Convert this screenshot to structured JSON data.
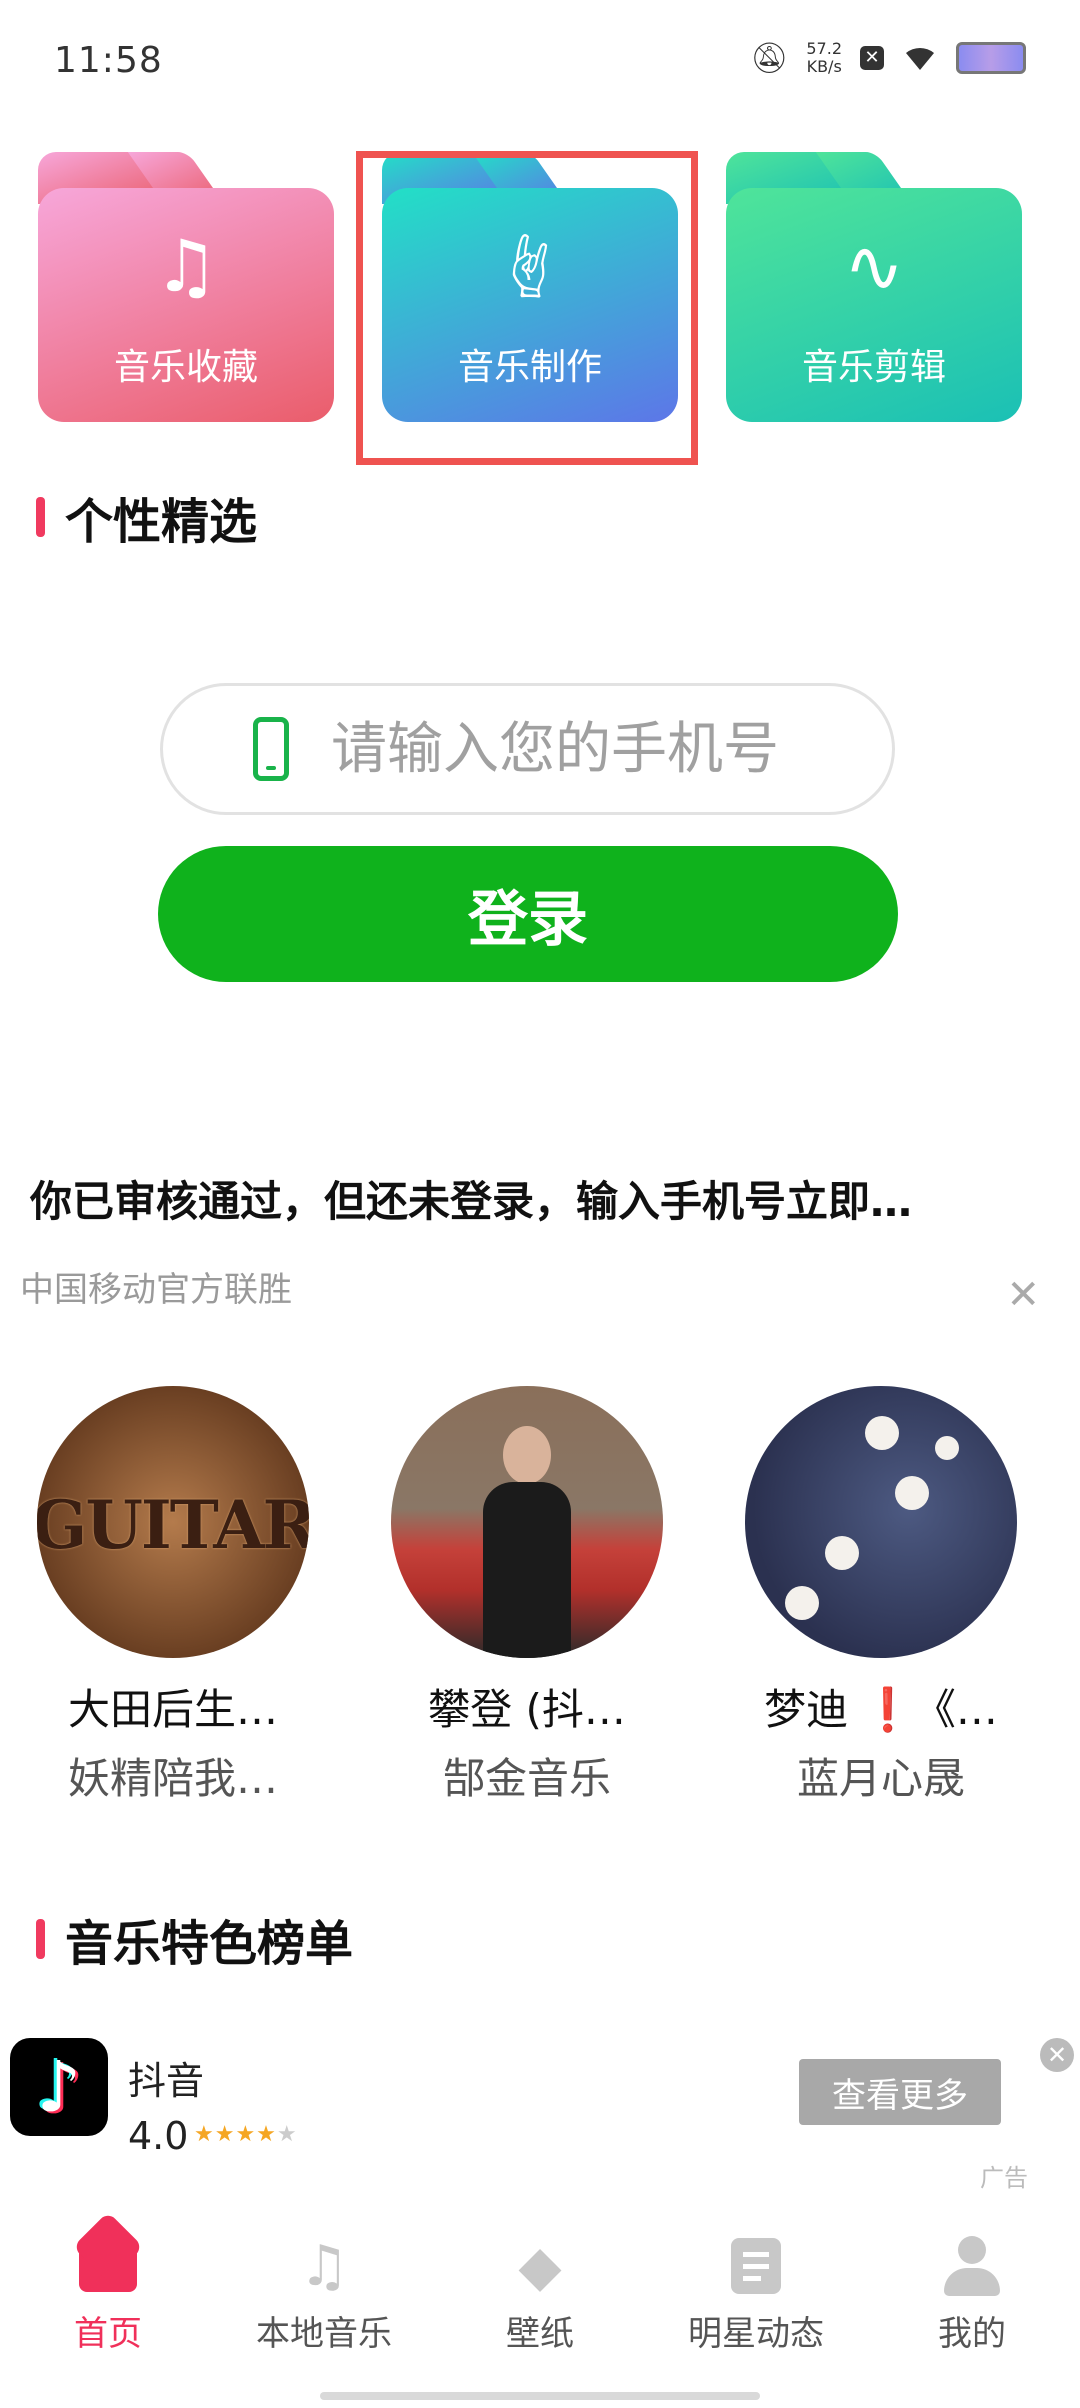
{
  "status_bar": {
    "time": "11:58",
    "speed_value": "57.2",
    "speed_unit": "KB/s"
  },
  "folders": [
    {
      "label": "音乐收藏",
      "icon": "music-note-icon"
    },
    {
      "label": "音乐制作",
      "icon": "rock-hand-icon"
    },
    {
      "label": "音乐剪辑",
      "icon": "audio-wave-icon"
    }
  ],
  "sections": {
    "featured": "个性精选",
    "charts": "音乐特色榜单"
  },
  "login": {
    "phone_placeholder": "请输入您的手机号",
    "button_label": "登录",
    "notice": "你已审核通过，但还未登录，输入手机号立即…",
    "source": "中国移动官方联胜"
  },
  "recommendations": [
    {
      "title": "大田后生…",
      "subtitle": "妖精陪我…",
      "image_text": "GUITAR"
    },
    {
      "title": "攀登 (抖…",
      "subtitle": "郜金音乐"
    },
    {
      "title": "梦迪 ❗《…",
      "subtitle": "蓝月心晟"
    }
  ],
  "ad": {
    "app_name": "抖音",
    "rating": "4.0",
    "button_label": "查看更多",
    "tag": "广告"
  },
  "nav": [
    {
      "label": "首页",
      "icon": "home-icon",
      "active": true
    },
    {
      "label": "本地音乐",
      "icon": "music-note-icon"
    },
    {
      "label": "壁纸",
      "icon": "wallpaper-icon"
    },
    {
      "label": "明星动态",
      "icon": "news-icon"
    },
    {
      "label": "我的",
      "icon": "profile-icon"
    }
  ],
  "colors": {
    "accent": "#f0305a",
    "login_green": "#0fb21c",
    "highlight_red": "#ef5350"
  }
}
